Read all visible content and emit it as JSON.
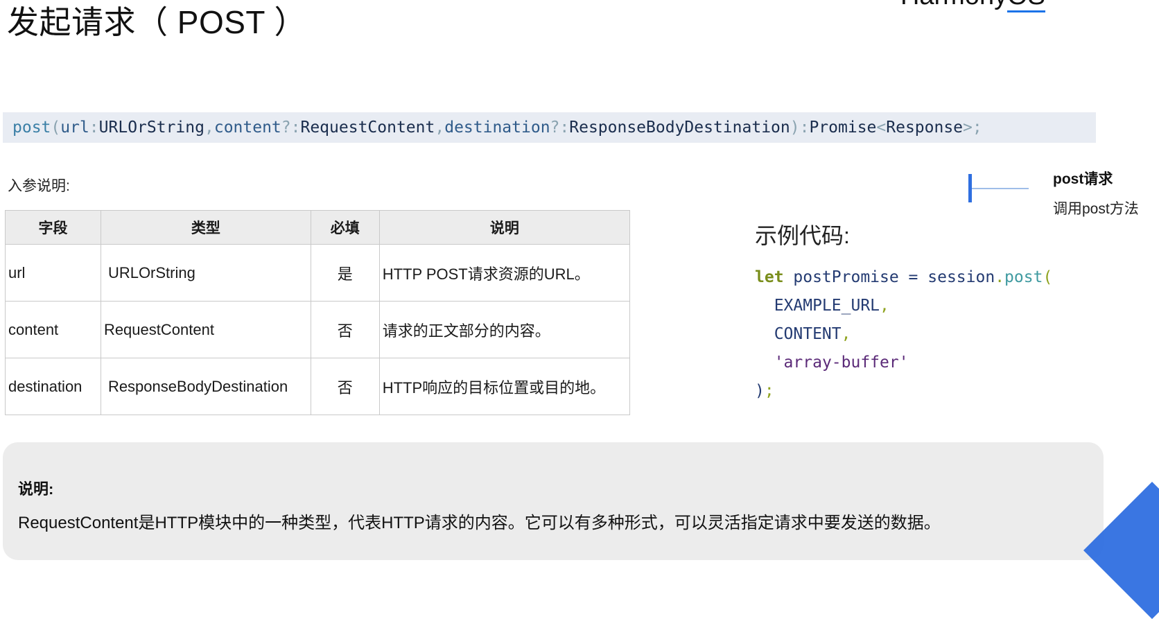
{
  "title": "发起请求（ POST ）",
  "brand": {
    "text_main": "Harmony",
    "text_os": "OS"
  },
  "signature": {
    "fn": "post",
    "open": "(",
    "p1_name": "url",
    "p1_sep": ": ",
    "p1_type": "URLOrString",
    "comma1": ", ",
    "p2_name": "content",
    "p2_sep": "?: ",
    "p2_type": "RequestContent",
    "comma2": ", ",
    "p3_name": "destination",
    "p3_sep": "?: ",
    "p3_type": "ResponseBodyDestination",
    "close": "): ",
    "ret_type": "Promise",
    "lt": "<",
    "ret_inner": "Response",
    "gt_end": ">;"
  },
  "params_label": "入参说明:",
  "table": {
    "headers": [
      "字段",
      "类型",
      "必填",
      "说明"
    ],
    "rows": [
      [
        "url",
        "URLOrString",
        "是",
        "HTTP POST请求资源的URL。"
      ],
      [
        "content",
        "RequestContent",
        "否",
        "请求的正文部分的内容。"
      ],
      [
        "destination",
        "ResponseBodyDestination",
        "否",
        "HTTP响应的目标位置或目的地。"
      ]
    ]
  },
  "annotation": {
    "title": "post请求",
    "desc": "调用post方法"
  },
  "example_title": "示例代码:",
  "code": {
    "kw_let": "let",
    "var": " postPromise = session",
    "dot": ".",
    "fn_post": "post",
    "paren_open": "(",
    "arg1": "  EXAMPLE_URL",
    "arg2": "  CONTENT",
    "arg3_indent": "  ",
    "arg3": "'array-buffer'",
    "comma": ",",
    "close": ")",
    "semi": ";"
  },
  "note": {
    "title": "说明:",
    "text": "RequestContent是HTTP模块中的一种类型，代表HTTP请求的内容。它可以有多种形式，可以灵活指定请求中要发送的数据。"
  },
  "colors": {
    "accent": "#2f6fe0",
    "signature_bg": "#e8ecf3",
    "note_bg": "#ececec"
  }
}
